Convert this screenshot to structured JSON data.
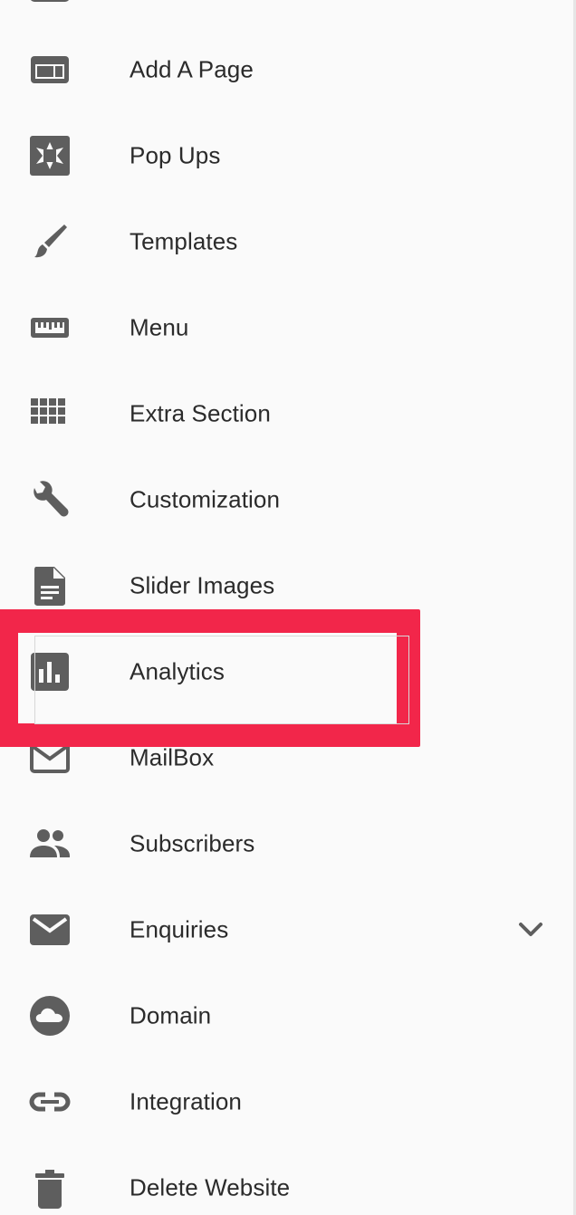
{
  "menu": {
    "items": [
      {
        "label": "Add A Page",
        "icon": "web-page-icon"
      },
      {
        "label": "Pop Ups",
        "icon": "popup-icon"
      },
      {
        "label": "Templates",
        "icon": "brush-icon"
      },
      {
        "label": "Menu",
        "icon": "ruler-icon"
      },
      {
        "label": "Extra Section",
        "icon": "grid-icon"
      },
      {
        "label": "Customization",
        "icon": "wrench-icon"
      },
      {
        "label": "Slider Images",
        "icon": "document-icon"
      },
      {
        "label": "Analytics",
        "icon": "bar-chart-icon"
      },
      {
        "label": "MailBox",
        "icon": "mail-outline-icon"
      },
      {
        "label": "Subscribers",
        "icon": "people-icon"
      },
      {
        "label": "Enquiries",
        "icon": "mail-icon"
      },
      {
        "label": "Domain",
        "icon": "cloud-icon"
      },
      {
        "label": "Integration",
        "icon": "link-icon"
      },
      {
        "label": "Delete Website",
        "icon": "trash-icon"
      }
    ],
    "highlighted_item": "Analytics",
    "expandable_item": "Enquiries"
  },
  "colors": {
    "icon": "#5e5e5e",
    "text": "#2b2b2b",
    "background": "#fafafa",
    "highlight": "#f2264a"
  }
}
